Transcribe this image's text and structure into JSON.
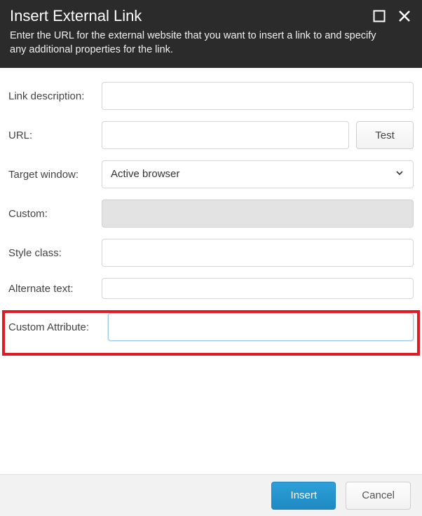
{
  "header": {
    "title": "Insert External Link",
    "subtitle": "Enter the URL for the external website that you want to insert a link to and specify any additional properties for the link."
  },
  "form": {
    "link_description": {
      "label": "Link description:",
      "value": ""
    },
    "url": {
      "label": "URL:",
      "value": "",
      "test_label": "Test"
    },
    "target_window": {
      "label": "Target window:",
      "value": "Active browser"
    },
    "custom": {
      "label": "Custom:",
      "value": ""
    },
    "style_class": {
      "label": "Style class:",
      "value": ""
    },
    "alternate_text": {
      "label": "Alternate text:",
      "value": ""
    },
    "custom_attribute": {
      "label": "Custom Attribute:",
      "value": ""
    }
  },
  "footer": {
    "insert_label": "Insert",
    "cancel_label": "Cancel"
  }
}
